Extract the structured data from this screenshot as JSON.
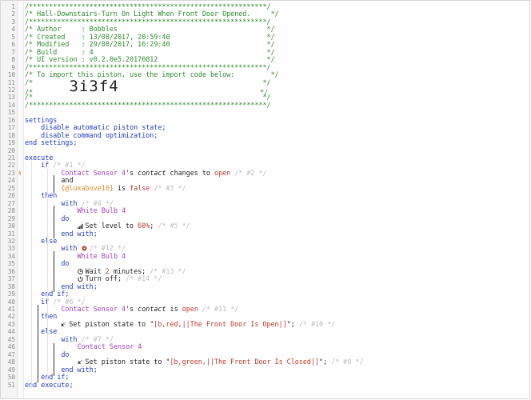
{
  "lines": [
    {
      "n": "1",
      "segs": [
        {
          "t": "/***********************************************************/",
          "c": "c"
        }
      ]
    },
    {
      "n": "2",
      "segs": [
        {
          "t": "/* Hall-Downstairs-Turn On Light When Front Door Opened.     */",
          "c": "c"
        }
      ]
    },
    {
      "n": "3",
      "segs": [
        {
          "t": "/***********************************************************/",
          "c": "c"
        }
      ]
    },
    {
      "n": "4",
      "segs": [
        {
          "t": "/* Author     : Bobbles                                     */",
          "c": "c"
        }
      ]
    },
    {
      "n": "5",
      "segs": [
        {
          "t": "/* Created    : 13/08/2017, 20:59:40                        */",
          "c": "c"
        }
      ]
    },
    {
      "n": "6",
      "segs": [
        {
          "t": "/* Modified   : 29/08/2017, 16:29:40                        */",
          "c": "c"
        }
      ]
    },
    {
      "n": "7",
      "segs": [
        {
          "t": "/* Build      : 4                                           */",
          "c": "c"
        }
      ]
    },
    {
      "n": "8",
      "segs": [
        {
          "t": "/* UI version : v0.2.0e5.20170812                           */",
          "c": "c"
        }
      ]
    },
    {
      "n": "9",
      "segs": [
        {
          "t": "/***********************************************************/",
          "c": "c"
        }
      ]
    },
    {
      "n": "10",
      "segs": [
        {
          "t": "/* To import this piston, use the import code below:         */",
          "c": "c"
        }
      ]
    },
    {
      "n": "11",
      "segs": [
        {
          "t": "/*                                                         */",
          "c": "c"
        }
      ]
    },
    {
      "n": "12",
      "segs": [
        {
          "t": "/*         ",
          "c": "c"
        },
        {
          "t": "3i3f4",
          "c": "big"
        },
        {
          "t": "                                   */",
          "c": "c"
        }
      ]
    },
    {
      "n": "13",
      "segs": [
        {
          "t": "/*                                                         */",
          "c": "c"
        }
      ]
    },
    {
      "n": "14",
      "segs": [
        {
          "t": "/***********************************************************/",
          "c": "c"
        }
      ]
    },
    {
      "n": "15",
      "segs": []
    },
    {
      "n": "16",
      "segs": [
        {
          "t": "settings",
          "c": "kw"
        }
      ]
    },
    {
      "n": "17",
      "segs": [
        {
          "t": "    disable automatic piston state;",
          "c": "kw"
        }
      ]
    },
    {
      "n": "18",
      "segs": [
        {
          "t": "    disable command optimization;",
          "c": "kw"
        }
      ]
    },
    {
      "n": "19",
      "segs": [
        {
          "t": "end settings;",
          "c": "kw"
        }
      ]
    },
    {
      "n": "20",
      "segs": []
    },
    {
      "n": "21",
      "segs": [
        {
          "t": "execute",
          "c": "kw"
        }
      ]
    },
    {
      "n": "22",
      "segs": [
        {
          "t": "    if ",
          "c": "kw"
        },
        {
          "t": "/* #1 */",
          "c": "cg"
        }
      ]
    },
    {
      "n": "23",
      "mark": "§",
      "segs": [
        {
          "t": "         "
        },
        {
          "t": "Contact Sensor 4",
          "c": "dev"
        },
        {
          "t": "'s "
        },
        {
          "t": "contact",
          "c": "em"
        },
        {
          "t": " changes to "
        },
        {
          "t": "open",
          "c": "op"
        },
        {
          "t": " /* #2 */",
          "c": "cg"
        }
      ]
    },
    {
      "n": "24",
      "segs": [
        {
          "t": "         and"
        }
      ]
    },
    {
      "n": "25",
      "segs": [
        {
          "t": "         "
        },
        {
          "t": "{@luxabove10}",
          "c": "var"
        },
        {
          "t": " is "
        },
        {
          "t": "false",
          "c": "op"
        },
        {
          "t": " /* #3 */",
          "c": "cg"
        }
      ]
    },
    {
      "n": "26",
      "segs": [
        {
          "t": "    then",
          "c": "kw"
        }
      ]
    },
    {
      "n": "27",
      "segs": [
        {
          "t": "         with ",
          "c": "kw"
        },
        {
          "t": "/* #4 */",
          "c": "cg"
        }
      ]
    },
    {
      "n": "28",
      "segs": [
        {
          "t": "             "
        },
        {
          "t": "White Bulb 4",
          "c": "dev"
        }
      ]
    },
    {
      "n": "29",
      "segs": [
        {
          "t": "         do",
          "c": "kw"
        }
      ]
    },
    {
      "n": "30",
      "segs": [
        {
          "t": "             "
        },
        {
          "icon": "signal-icon"
        },
        {
          "t": "Set level to "
        },
        {
          "t": "60%",
          "c": "op"
        },
        {
          "t": "; "
        },
        {
          "t": "/* #5 */",
          "c": "cg"
        }
      ]
    },
    {
      "n": "31",
      "segs": [
        {
          "t": "         end with;",
          "c": "kw"
        }
      ]
    },
    {
      "n": "32",
      "segs": [
        {
          "t": "    else",
          "c": "kw"
        }
      ]
    },
    {
      "n": "33",
      "segs": [
        {
          "t": "         with ",
          "c": "kw"
        },
        {
          "icon": "gear-icon"
        },
        {
          "t": "/* #12 */",
          "c": "cg"
        }
      ]
    },
    {
      "n": "34",
      "segs": [
        {
          "t": "             "
        },
        {
          "t": "White Bulb 4",
          "c": "dev"
        }
      ]
    },
    {
      "n": "35",
      "segs": [
        {
          "t": "         do",
          "c": "kw"
        }
      ]
    },
    {
      "n": "36",
      "segs": [
        {
          "t": "             "
        },
        {
          "icon": "clock-icon"
        },
        {
          "t": "Wait "
        },
        {
          "t": "2",
          "c": "op"
        },
        {
          "t": " minutes; "
        },
        {
          "t": "/* #13 */",
          "c": "cg"
        }
      ]
    },
    {
      "n": "37",
      "segs": [
        {
          "t": "             "
        },
        {
          "icon": "power-icon"
        },
        {
          "t": "Turn off; "
        },
        {
          "t": "/* #14 */",
          "c": "cg"
        }
      ]
    },
    {
      "n": "38",
      "segs": [
        {
          "t": "         end with;",
          "c": "kw"
        }
      ]
    },
    {
      "n": "39",
      "segs": [
        {
          "t": "    end if;",
          "c": "kw"
        }
      ]
    },
    {
      "n": "40",
      "segs": [
        {
          "t": "    if ",
          "c": "kw"
        },
        {
          "t": "/* #6 */",
          "c": "cg"
        }
      ]
    },
    {
      "n": "41",
      "segs": [
        {
          "t": "         "
        },
        {
          "t": "Contact Sensor 4",
          "c": "dev"
        },
        {
          "t": "'s "
        },
        {
          "t": "contact",
          "c": "em"
        },
        {
          "t": " is "
        },
        {
          "t": "open",
          "c": "op"
        },
        {
          "t": " /* #11 */",
          "c": "cg"
        }
      ]
    },
    {
      "n": "42",
      "segs": [
        {
          "t": "    then",
          "c": "kw"
        }
      ]
    },
    {
      "n": "43",
      "segs": [
        {
          "t": "         "
        },
        {
          "icon": "x2-icon"
        },
        {
          "t": "Set piston state to \""
        },
        {
          "t": "[b,red,||The Front Door Is Open|]",
          "c": "op"
        },
        {
          "t": "\"; "
        },
        {
          "t": "/* #10 */",
          "c": "cg"
        }
      ]
    },
    {
      "n": "44",
      "segs": [
        {
          "t": "    else",
          "c": "kw"
        }
      ]
    },
    {
      "n": "45",
      "segs": [
        {
          "t": "         with ",
          "c": "kw"
        },
        {
          "t": "/* #7 */",
          "c": "cg"
        }
      ]
    },
    {
      "n": "46",
      "segs": [
        {
          "t": "             "
        },
        {
          "t": "Contact Sensor 4",
          "c": "dev"
        }
      ]
    },
    {
      "n": "47",
      "segs": [
        {
          "t": "         do",
          "c": "kw"
        }
      ]
    },
    {
      "n": "48",
      "segs": [
        {
          "t": "             "
        },
        {
          "icon": "x2-icon"
        },
        {
          "t": "Set piston state to \""
        },
        {
          "t": "[b,green,||The Front Door Is Closed|]",
          "c": "op"
        },
        {
          "t": "\"; "
        },
        {
          "t": "/* #8 */",
          "c": "cg"
        }
      ]
    },
    {
      "n": "49",
      "segs": [
        {
          "t": "         end with;",
          "c": "kw"
        }
      ]
    },
    {
      "n": "50",
      "segs": [
        {
          "t": "    end if;",
          "c": "kw"
        }
      ]
    },
    {
      "n": "51",
      "segs": [
        {
          "t": "end execute;",
          "c": "kw"
        }
      ]
    }
  ]
}
